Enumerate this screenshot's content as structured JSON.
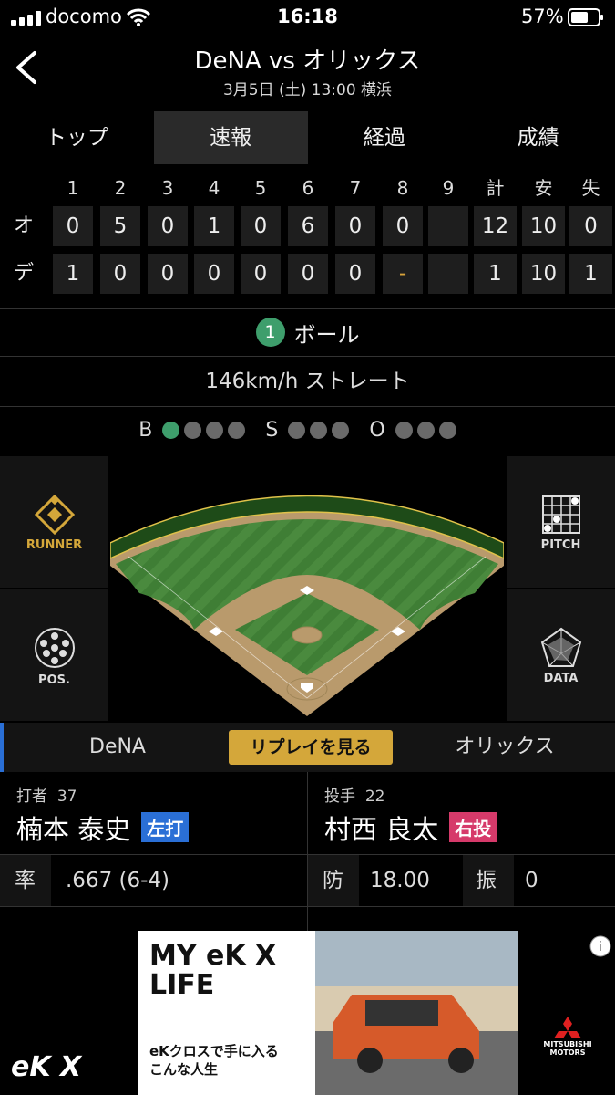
{
  "status_bar": {
    "carrier": "docomo",
    "time": "16:18",
    "battery_pct": "57%"
  },
  "header": {
    "title": "DeNA vs オリックス",
    "subtitle": "3月5日 (土) 13:00 横浜"
  },
  "tabs": [
    {
      "label": "トップ",
      "active": false
    },
    {
      "label": "速報",
      "active": true
    },
    {
      "label": "経過",
      "active": false
    },
    {
      "label": "成績",
      "active": false
    }
  ],
  "scoreboard": {
    "headers": [
      "1",
      "2",
      "3",
      "4",
      "5",
      "6",
      "7",
      "8",
      "9",
      "計",
      "安",
      "失"
    ],
    "rows": [
      {
        "team": "オ",
        "innings": [
          "0",
          "5",
          "0",
          "1",
          "0",
          "6",
          "0",
          "0",
          ""
        ],
        "totals": [
          "12",
          "10",
          "0"
        ]
      },
      {
        "team": "デ",
        "innings": [
          "1",
          "0",
          "0",
          "0",
          "0",
          "0",
          "0",
          "-",
          ""
        ],
        "totals": [
          "1",
          "10",
          "1"
        ]
      }
    ]
  },
  "pitch_result": {
    "number": "1",
    "result": "ボール",
    "detail": "146km/h ストレート"
  },
  "count": {
    "balls_label": "B",
    "balls": 1,
    "balls_max": 4,
    "strikes_label": "S",
    "strikes": 0,
    "strikes_max": 3,
    "outs_label": "O",
    "outs": 0,
    "outs_max": 3
  },
  "side_buttons": {
    "runner": "RUNNER",
    "pitch": "PITCH",
    "pos": "POS.",
    "data": "DATA"
  },
  "team_bar": {
    "home": "DeNA",
    "replay": "リプレイを見る",
    "away": "オリックス"
  },
  "batter": {
    "role": "打者",
    "number": "37",
    "name": "楠本 泰史",
    "hand": "左打",
    "hand_color": "#2a6fd6",
    "stat_label": "率",
    "stat_value": ".667 (6-4)"
  },
  "pitcher": {
    "role": "投手",
    "number": "22",
    "name": "村西 良太",
    "hand": "右投",
    "hand_color": "#d63a6a",
    "stat1_label": "防",
    "stat1_value": "18.00",
    "stat2_label": "振",
    "stat2_value": "0"
  },
  "ad": {
    "headline": "MY eK X LIFE",
    "copy": "eKクロスで手に入る\nこんな人生",
    "brand": "MITSUBISHI MOTORS",
    "logo": "eK X"
  },
  "colors": {
    "accent_green": "#3e9e6c",
    "replay_gold": "#d4a73a",
    "home_blue": "#2a6fd6"
  }
}
